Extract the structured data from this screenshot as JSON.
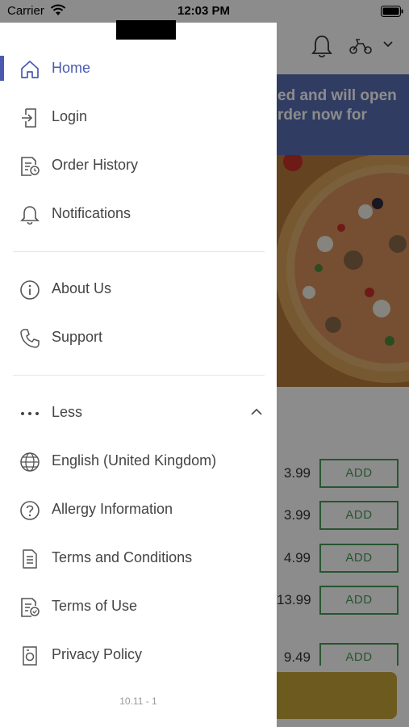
{
  "status_bar": {
    "carrier": "Carrier",
    "time": "12:03 PM"
  },
  "background": {
    "banner_line1": "ed and will open",
    "banner_line2": "rder now for",
    "items": [
      {
        "price": "3.99",
        "button": "ADD"
      },
      {
        "price": "3.99",
        "button": "ADD"
      },
      {
        "price": "4.99",
        "button": "ADD"
      },
      {
        "price": "13.99",
        "button": "ADD"
      },
      {
        "price": "9.49",
        "button": "ADD"
      }
    ]
  },
  "drawer": {
    "primary": [
      {
        "label": "Home",
        "icon": "home-icon",
        "active": true
      },
      {
        "label": "Login",
        "icon": "login-icon"
      },
      {
        "label": "Order History",
        "icon": "order-history-icon"
      },
      {
        "label": "Notifications",
        "icon": "bell-icon"
      }
    ],
    "secondary": [
      {
        "label": "About Us",
        "icon": "info-icon"
      },
      {
        "label": "Support",
        "icon": "phone-icon"
      }
    ],
    "less_label": "Less",
    "more": [
      {
        "label": "English (United Kingdom)",
        "icon": "globe-icon"
      },
      {
        "label": "Allergy Information",
        "icon": "question-icon"
      },
      {
        "label": "Terms and Conditions",
        "icon": "document-icon"
      },
      {
        "label": "Terms of Use",
        "icon": "document-check-icon"
      },
      {
        "label": "Privacy Policy",
        "icon": "privacy-icon"
      }
    ],
    "version": "10.11 - 1"
  },
  "colors": {
    "accent": "#4a5ab0",
    "banner": "#5a6db5",
    "add_button": "#4a9b5a",
    "basket": "#c7a53a"
  }
}
